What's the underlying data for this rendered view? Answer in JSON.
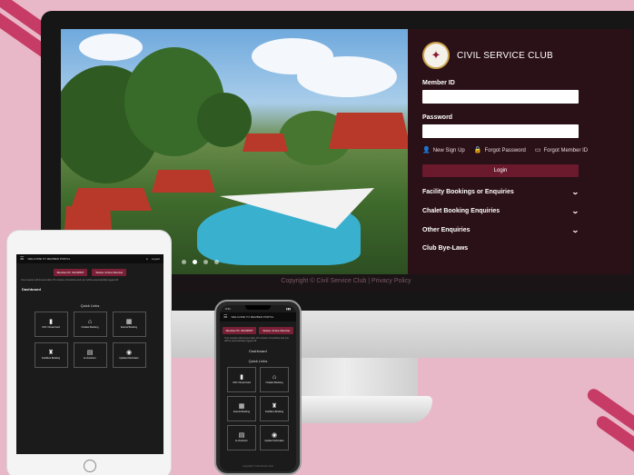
{
  "desktop": {
    "club_name": "CIVIL SERVICE CLUB",
    "member_id_label": "Member ID",
    "password_label": "Password",
    "links": [
      "New Sign Up",
      "Forgot Password",
      "Forgot Member ID"
    ],
    "login_button": "Login",
    "accordion": [
      {
        "label": "Facility Bookings or Enquiries",
        "chevron": true
      },
      {
        "label": "Chalet Booking Enquiries",
        "chevron": true
      },
      {
        "label": "Other Enquiries",
        "chevron": true
      },
      {
        "label": "Club Bye-Laws",
        "chevron": false
      }
    ],
    "footer": "Copyright © Civil Service Club | Privacy Policy"
  },
  "mobile": {
    "welcome": "WELCOME TO MEMBER PORTAL",
    "member_pill": "Member ID: 01234567",
    "status_pill": "Status: Active Member",
    "logout": "Logout",
    "notice": "Your session will timeout after 15 minutes of inactivity and you will be automatically logged off.",
    "dashboard": "Dashboard",
    "quick_links_title": "Quick Links",
    "quick_links": [
      {
        "label": "CSC Virtual Card",
        "icon": "▮"
      },
      {
        "label": "Chalets Booking",
        "icon": "⌂"
      },
      {
        "label": "Events Booking",
        "icon": "▦"
      },
      {
        "label": "Facilities Booking",
        "icon": "♜"
      },
      {
        "label": "E-Vouchers",
        "icon": "▤"
      },
      {
        "label": "Update Particulars",
        "icon": "◉"
      }
    ],
    "phone_time": "9:41",
    "phone_footer": "Copyright © Civil Service Club"
  },
  "colors": {
    "panel": "#2a1017",
    "accent": "#7a1f35",
    "background": "#e9b8c8"
  }
}
